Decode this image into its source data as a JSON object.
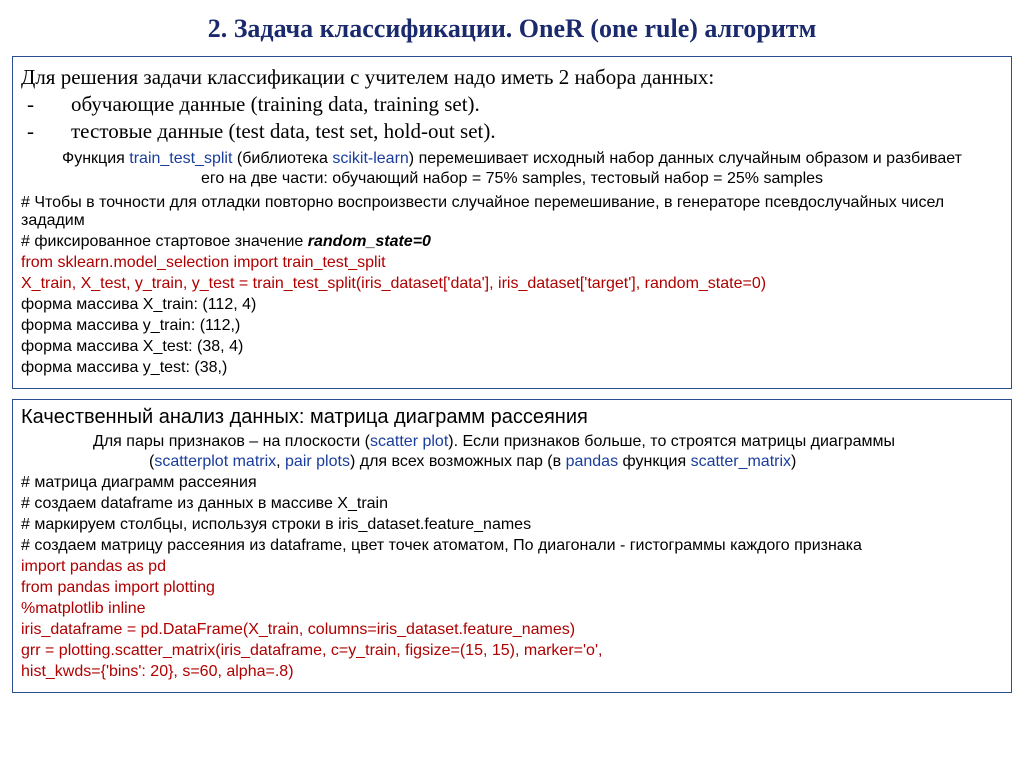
{
  "title": "2. Задача классификации. OneR (one rule) алгоритм",
  "panel1": {
    "intro": "Для решения задачи классификации с учителем надо иметь 2 набора данных:",
    "bullet1": "обучающие данные (training data, training set).",
    "bullet2": "тестовые данные (test data, test set, hold-out set).",
    "note_pre": "Функция ",
    "note_fn": "train_test_split",
    "note_mid1": " (библиотека ",
    "note_lib": "scikit-learn",
    "note_post1": ") перемешивает исходный набор данных случайным образом и разбивает",
    "note_line2": "его на две части: обучающий набор = 75% samples, тестовый набор = 25% samples",
    "comment1": "# Чтобы в точности для отладки повторно воспроизвести случайное перемешивание, в генераторе псевдослучайных чисел зададим",
    "comment2_pre": "# фиксированное стартовое значение ",
    "comment2_em": "random_state=0",
    "code1": "from sklearn.model_selection import train_test_split",
    "code2": "X_train, X_test, y_train, y_test = train_test_split(iris_dataset['data'], iris_dataset['target'], random_state=0)",
    "shape1": "форма массива X_train: (112, 4)",
    "shape2": "форма массива y_train: (112,)",
    "shape3": "форма массива X_test: (38, 4)",
    "shape4": "форма массива y_test: (38,)"
  },
  "panel2": {
    "heading": "Качественный анализ данных: матрица диаграмм рассеяния",
    "sub1_pre": "Для пары признаков – на плоскости (",
    "sub1_link1": "scatter plot",
    "sub1_post": "). Если признаков больше, то строятся матрицы диаграммы",
    "sub2_pre": "(",
    "sub2_link1": "scatterplot matrix",
    "sub2_sep": ", ",
    "sub2_link2": "pair plots",
    "sub2_mid": ") для всех возможных пар (в ",
    "sub2_link3": "pandas",
    "sub2_mid2": " функция ",
    "sub2_link4": "scatter_matrix",
    "sub2_post": ")",
    "c1": "# матрица диаграмм рассеяния",
    "c2": "# создаем dataframe из данных в массиве X_train",
    "c3": "# маркируем столбцы, используя строки в iris_dataset.feature_names",
    "c4": "# создаем матрицу рассеяния из dataframe, цвет точек атоматом, По диагонали - гистограммы каждого признака",
    "code1": "import pandas as pd",
    "code2": "from pandas import plotting",
    "code3": "%matplotlib inline",
    "code4": "iris_dataframe = pd.DataFrame(X_train, columns=iris_dataset.feature_names)",
    "code5": "grr = plotting.scatter_matrix(iris_dataframe, c=y_train, figsize=(15, 15), marker='o',",
    "code6": "hist_kwds={'bins': 20}, s=60, alpha=.8)"
  }
}
